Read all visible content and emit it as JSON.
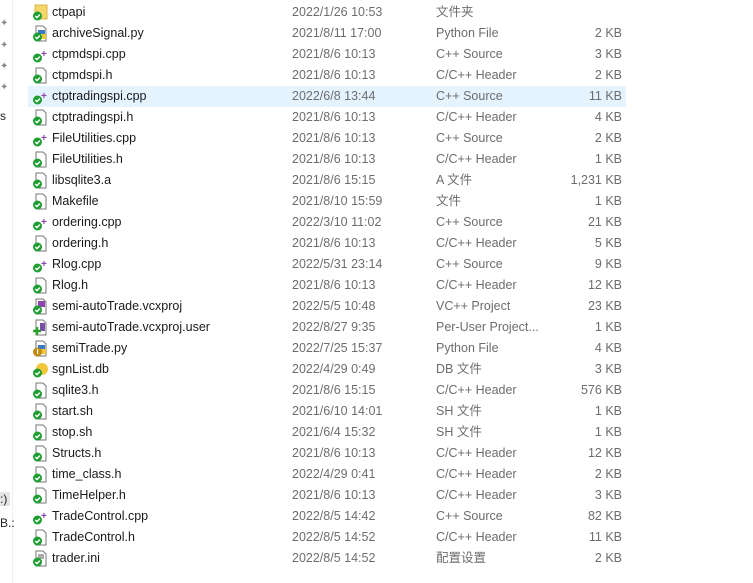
{
  "nav": {
    "labels": [
      "s",
      ":)",
      "B.:"
    ]
  },
  "files": [
    {
      "name": "ctpapi",
      "date": "2022/1/26 10:53",
      "type": "文件夹",
      "size": "",
      "icon": "folder-icon"
    },
    {
      "name": "archiveSignal.py",
      "date": "2021/8/11 17:00",
      "type": "Python File",
      "size": "2 KB",
      "icon": "python-file-icon"
    },
    {
      "name": "ctpmdspi.cpp",
      "date": "2021/8/6 10:13",
      "type": "C++ Source",
      "size": "3 KB",
      "icon": "cpp-file-icon"
    },
    {
      "name": "ctpmdspi.h",
      "date": "2021/8/6 10:13",
      "type": "C/C++ Header",
      "size": "2 KB",
      "icon": "header-file-icon"
    },
    {
      "name": "ctptradingspi.cpp",
      "date": "2022/6/8 13:44",
      "type": "C++ Source",
      "size": "11 KB",
      "icon": "cpp-file-icon",
      "selected": true
    },
    {
      "name": "ctptradingspi.h",
      "date": "2021/8/6 10:13",
      "type": "C/C++ Header",
      "size": "4 KB",
      "icon": "header-file-icon"
    },
    {
      "name": "FileUtilities.cpp",
      "date": "2021/8/6 10:13",
      "type": "C++ Source",
      "size": "2 KB",
      "icon": "cpp-file-icon"
    },
    {
      "name": "FileUtilities.h",
      "date": "2021/8/6 10:13",
      "type": "C/C++ Header",
      "size": "1 KB",
      "icon": "header-file-icon"
    },
    {
      "name": "libsqlite3.a",
      "date": "2021/8/6 15:15",
      "type": "A 文件",
      "size": "1,231 KB",
      "icon": "file-icon"
    },
    {
      "name": "Makefile",
      "date": "2021/8/10 15:59",
      "type": "文件",
      "size": "1 KB",
      "icon": "file-icon"
    },
    {
      "name": "ordering.cpp",
      "date": "2022/3/10 11:02",
      "type": "C++ Source",
      "size": "21 KB",
      "icon": "cpp-file-icon"
    },
    {
      "name": "ordering.h",
      "date": "2021/8/6 10:13",
      "type": "C/C++ Header",
      "size": "5 KB",
      "icon": "header-file-icon"
    },
    {
      "name": "Rlog.cpp",
      "date": "2022/5/31 23:14",
      "type": "C++ Source",
      "size": "9 KB",
      "icon": "cpp-file-icon"
    },
    {
      "name": "Rlog.h",
      "date": "2021/8/6 10:13",
      "type": "C/C++ Header",
      "size": "12 KB",
      "icon": "header-file-icon"
    },
    {
      "name": "semi-autoTrade.vcxproj",
      "date": "2022/5/5 10:48",
      "type": "VC++ Project",
      "size": "23 KB",
      "icon": "vcxproj-file-icon"
    },
    {
      "name": "semi-autoTrade.vcxproj.user",
      "date": "2022/8/27 9:35",
      "type": "Per-User Project...",
      "size": "1 KB",
      "icon": "user-file-icon"
    },
    {
      "name": "semiTrade.py",
      "date": "2022/7/25 15:37",
      "type": "Python File",
      "size": "4 KB",
      "icon": "python-file-modified-icon"
    },
    {
      "name": "sgnList.db",
      "date": "2022/4/29 0:49",
      "type": "DB 文件",
      "size": "3 KB",
      "icon": "db-file-icon"
    },
    {
      "name": "sqlite3.h",
      "date": "2021/8/6 15:15",
      "type": "C/C++ Header",
      "size": "576 KB",
      "icon": "header-file-icon"
    },
    {
      "name": "start.sh",
      "date": "2021/6/10 14:01",
      "type": "SH 文件",
      "size": "1 KB",
      "icon": "file-icon"
    },
    {
      "name": "stop.sh",
      "date": "2021/6/4 15:32",
      "type": "SH 文件",
      "size": "1 KB",
      "icon": "file-icon"
    },
    {
      "name": "Structs.h",
      "date": "2021/8/6 10:13",
      "type": "C/C++ Header",
      "size": "12 KB",
      "icon": "header-file-icon"
    },
    {
      "name": "time_class.h",
      "date": "2022/4/29 0:41",
      "type": "C/C++ Header",
      "size": "2 KB",
      "icon": "header-file-icon"
    },
    {
      "name": "TimeHelper.h",
      "date": "2021/8/6 10:13",
      "type": "C/C++ Header",
      "size": "3 KB",
      "icon": "header-file-icon"
    },
    {
      "name": "TradeControl.cpp",
      "date": "2022/8/5 14:42",
      "type": "C++ Source",
      "size": "82 KB",
      "icon": "cpp-file-icon"
    },
    {
      "name": "TradeControl.h",
      "date": "2022/8/5 14:52",
      "type": "C/C++ Header",
      "size": "11 KB",
      "icon": "header-file-icon"
    },
    {
      "name": "trader.ini",
      "date": "2022/8/5 14:52",
      "type": "配置设置",
      "size": "2 KB",
      "icon": "ini-file-icon"
    }
  ],
  "colors": {
    "selection": "#e5f3ff",
    "check_badge": "#1e9e33",
    "modified_badge": "#c08a10"
  }
}
